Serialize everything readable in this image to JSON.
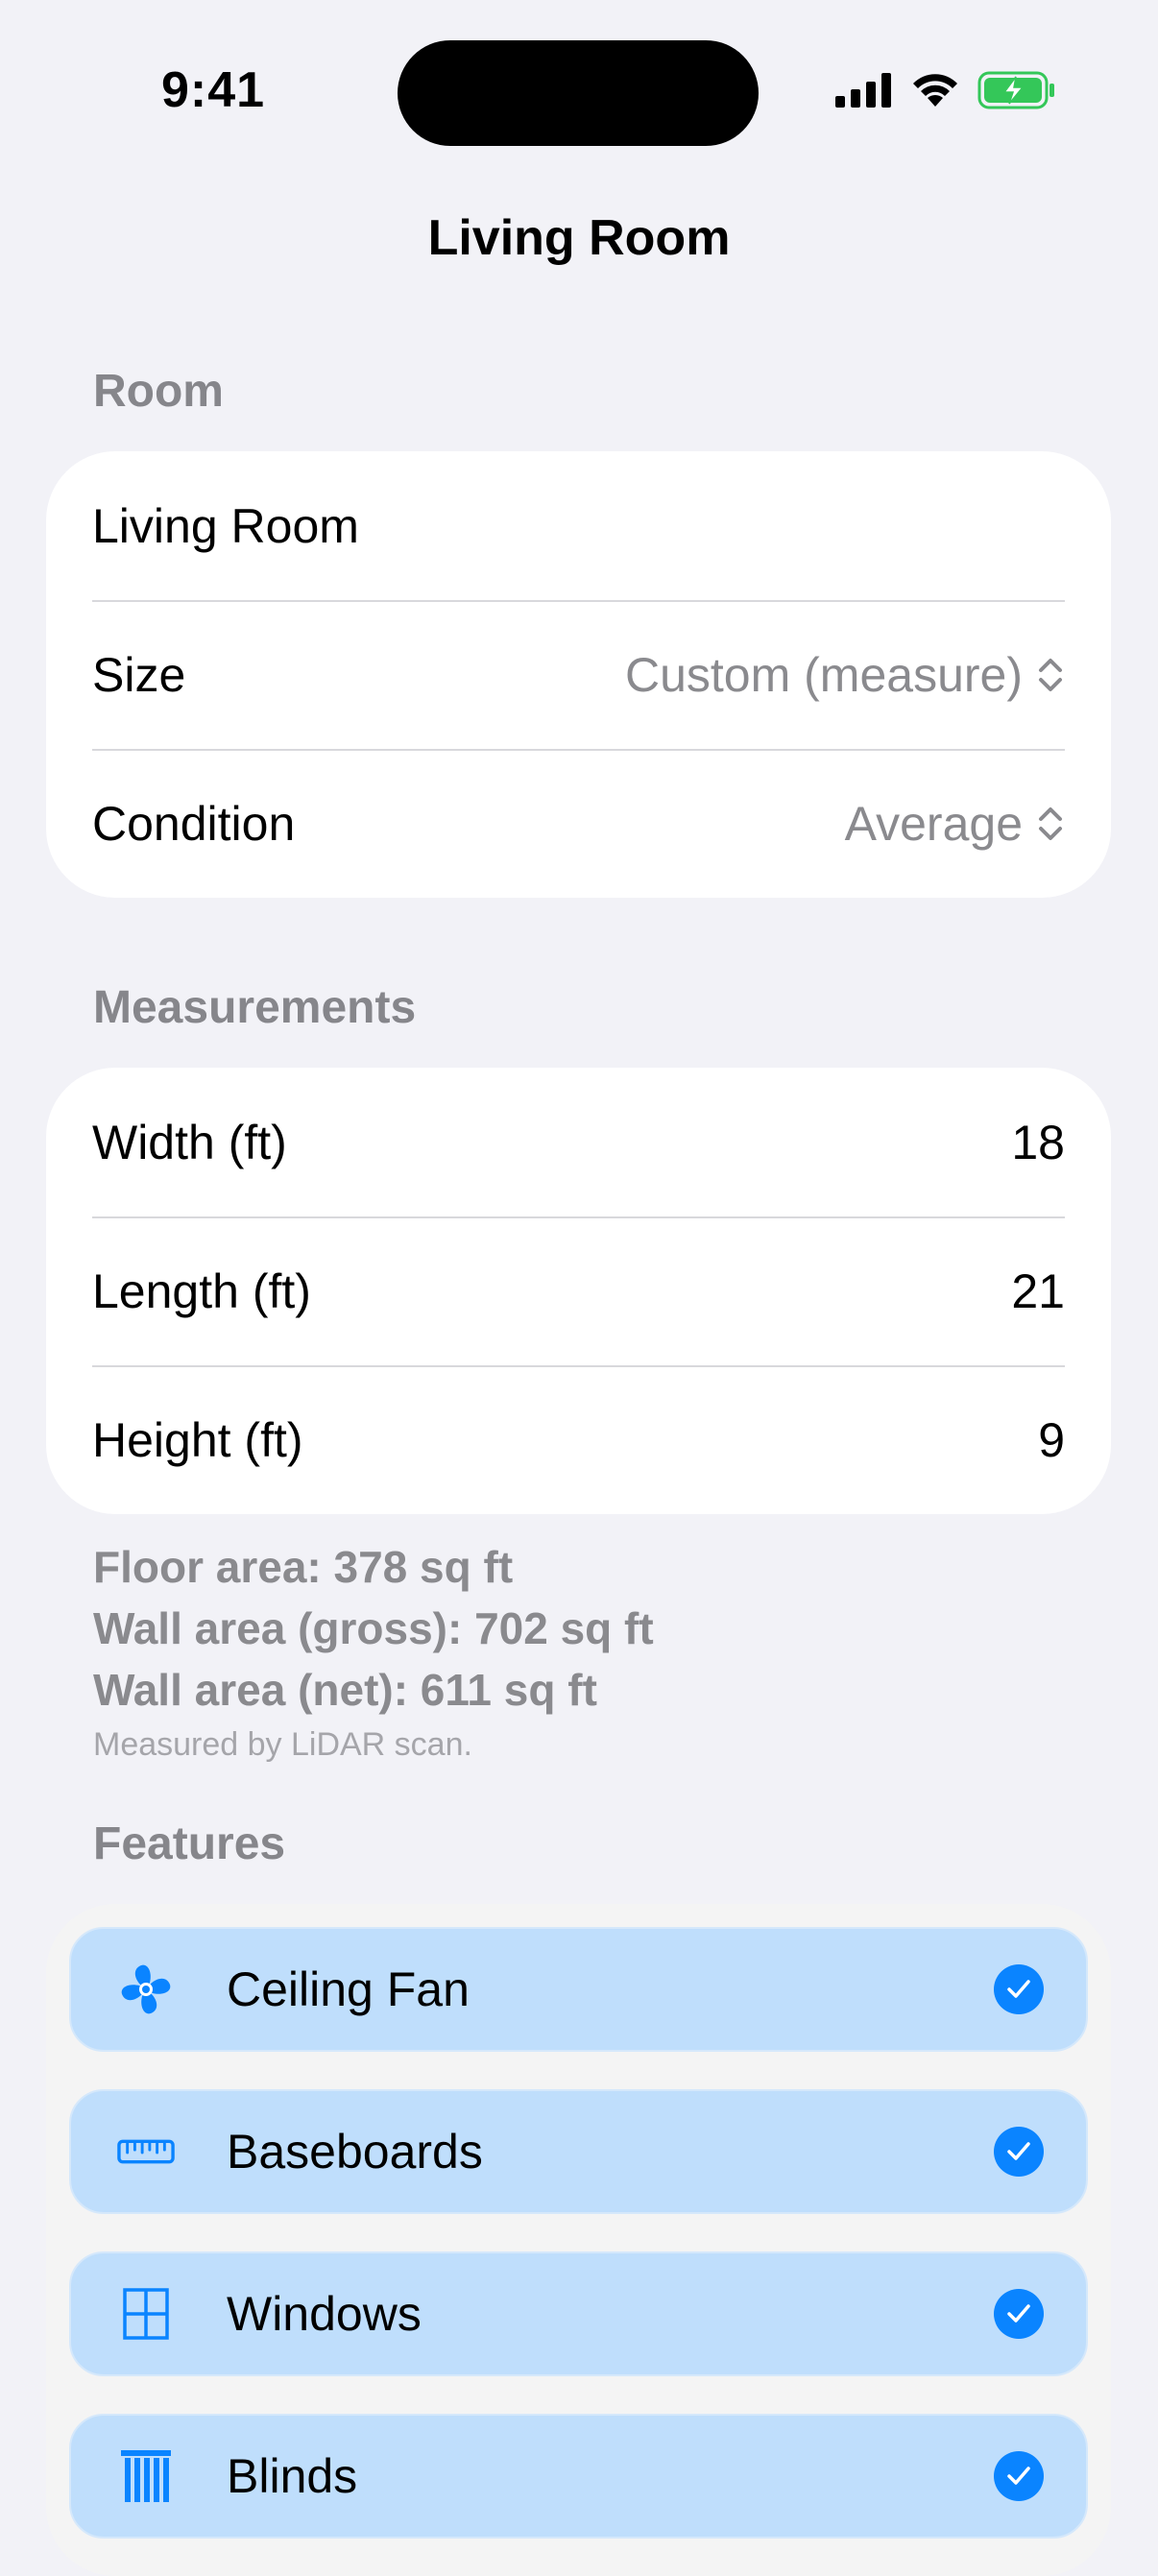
{
  "status_bar": {
    "time": "9:41"
  },
  "nav": {
    "title": "Living Room"
  },
  "room_section": {
    "header": "Room",
    "name_value": "Living Room",
    "size_label": "Size",
    "size_value": "Custom (measure)",
    "condition_label": "Condition",
    "condition_value": "Average"
  },
  "measurements_section": {
    "header": "Measurements",
    "rows": [
      {
        "label": "Width (ft)",
        "value": "18"
      },
      {
        "label": "Length (ft)",
        "value": "21"
      },
      {
        "label": "Height (ft)",
        "value": "9"
      }
    ],
    "floor_area": "Floor area: 378 sq ft",
    "wall_area_gross": "Wall area (gross): 702 sq ft",
    "wall_area_net": "Wall area (net): 611 sq ft",
    "note": "Measured by LiDAR scan."
  },
  "features_section": {
    "header": "Features",
    "items": [
      {
        "label": "Ceiling Fan",
        "icon": "fan-icon",
        "checked": true
      },
      {
        "label": "Baseboards",
        "icon": "ruler-icon",
        "checked": true
      },
      {
        "label": "Windows",
        "icon": "window-icon",
        "checked": true
      },
      {
        "label": "Blinds",
        "icon": "blinds-icon",
        "checked": true
      }
    ]
  },
  "colors": {
    "accent": "#0a84ff",
    "feature_bg": "#bfdefc",
    "background": "#f2f2f7",
    "secondary_text": "#8a8a8e"
  }
}
